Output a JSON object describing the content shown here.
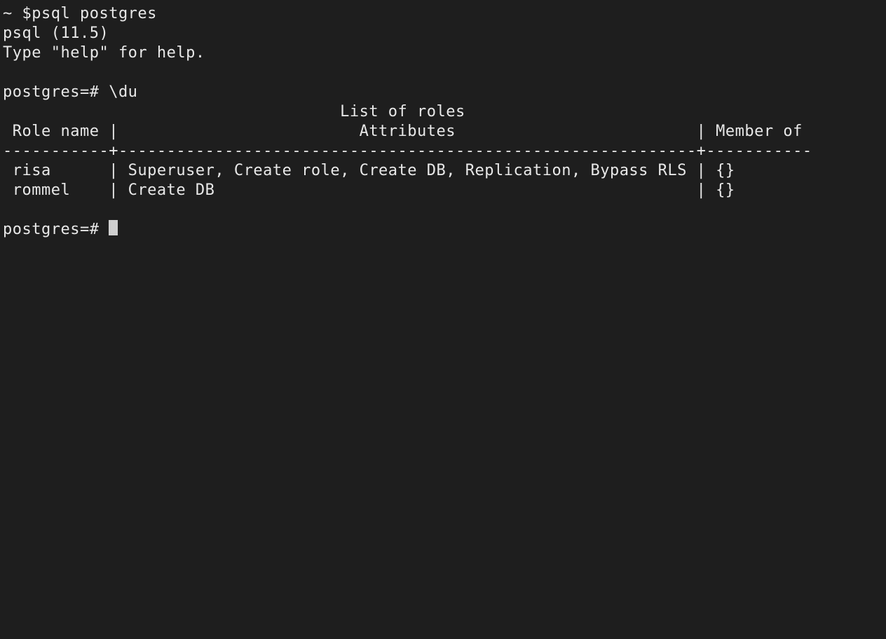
{
  "shell": {
    "prompt_line": "~ $psql postgres",
    "version_line": "psql (11.5)",
    "help_line": "Type \"help\" for help."
  },
  "psql": {
    "command_line": "postgres=# \\du",
    "table_title": "                                   List of roles",
    "headers_line": " Role name |                         Attributes                         | Member of ",
    "sep_line": "-----------+------------------------------------------------------------+-----------",
    "rows": [
      " risa      | Superuser, Create role, Create DB, Replication, Bypass RLS | {}",
      " rommel    | Create DB                                                  | {}"
    ],
    "prompt_after": "postgres=# "
  },
  "roles_table": {
    "columns": [
      "Role name",
      "Attributes",
      "Member of"
    ],
    "rows": [
      {
        "role_name": "risa",
        "attributes": "Superuser, Create role, Create DB, Replication, Bypass RLS",
        "member_of": "{}"
      },
      {
        "role_name": "rommel",
        "attributes": "Create DB",
        "member_of": "{}"
      }
    ]
  }
}
